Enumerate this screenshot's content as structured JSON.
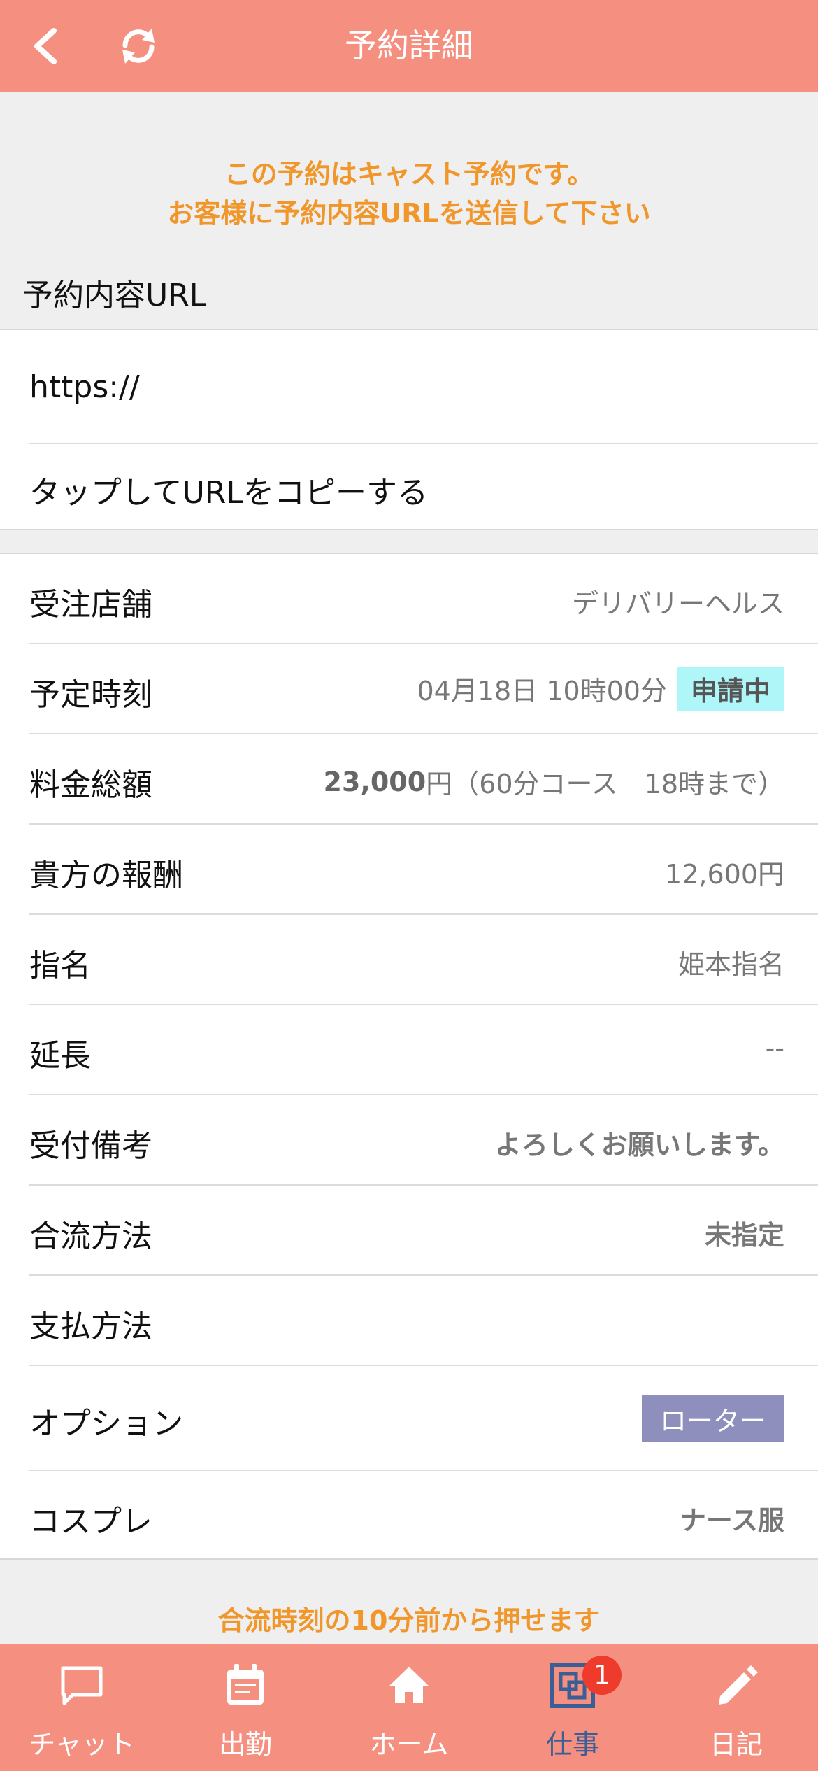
{
  "header": {
    "title": "予約詳細",
    "back_icon": "back-chevron-icon",
    "reload_icon": "reload-icon"
  },
  "notice": {
    "line1": "この予約はキャスト予約です。",
    "line2": "お客様に予約内容URLを送信して下さい"
  },
  "url_section": {
    "label": "予約内容URL",
    "url": "https://",
    "copy_action": "タップしてURLをコピーする"
  },
  "details": {
    "store": {
      "label": "受注店舗",
      "value": "デリバリーヘルス"
    },
    "scheduled_time": {
      "label": "予定時刻",
      "value": "04月18日 10時00分",
      "status": "申請中"
    },
    "total_fee": {
      "label": "料金総額",
      "amount": "23,000",
      "unit": "円",
      "course": "（60分コース　18時まで）"
    },
    "reward": {
      "label": "貴方の報酬",
      "value": "12,600円"
    },
    "nomination": {
      "label": "指名",
      "value": "姫本指名"
    },
    "extension": {
      "label": "延長",
      "value": "--"
    },
    "reception_note": {
      "label": "受付備考",
      "value": "よろしくお願いします。"
    },
    "meeting_method": {
      "label": "合流方法",
      "value": "未指定"
    },
    "payment_method": {
      "label": "支払方法",
      "value": ""
    },
    "option": {
      "label": "オプション",
      "value": "ローター"
    },
    "cosplay": {
      "label": "コスプレ",
      "value": "ナース服"
    }
  },
  "footer_note": "合流時刻の10分前から押せます",
  "tabbar": {
    "items": [
      {
        "label": "チャット",
        "icon": "chat-icon"
      },
      {
        "label": "出勤",
        "icon": "calendar-icon"
      },
      {
        "label": "ホーム",
        "icon": "home-icon"
      },
      {
        "label": "仕事",
        "icon": "work-icon",
        "badge": "1"
      },
      {
        "label": "日記",
        "icon": "pencil-icon"
      }
    ],
    "active_index": 3
  },
  "colors": {
    "accent": "#f58f80",
    "notice_text": "#f0962a",
    "active_tab": "#3a5f97",
    "pending_badge": "#aef6f8",
    "option_badge": "#8f8fbd",
    "tab_badge": "#ef3b2c"
  }
}
